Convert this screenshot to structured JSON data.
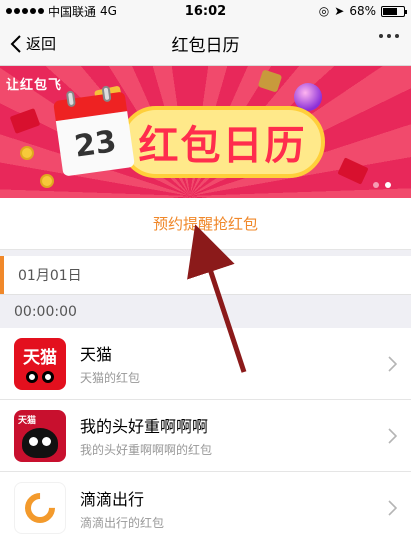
{
  "statusbar": {
    "carrier": "中国联通",
    "network": "4G",
    "time": "16:02",
    "battery": "68%",
    "battery_level": 0.68
  },
  "navbar": {
    "back_label": "返回",
    "title": "红包日历"
  },
  "banner": {
    "logo_text": "让红包飞",
    "calendar_day": "23",
    "headline": "红包日历",
    "page_count": 2,
    "active_page": 1
  },
  "reminder": {
    "label": "预约提醒抢红包",
    "color": "#f0882a"
  },
  "schedule": {
    "date": "01月01日",
    "time": "00:00:00",
    "items": [
      {
        "name": "天猫",
        "desc": "天猫的红包",
        "icon": "tmall-icon"
      },
      {
        "name": "我的头好重啊啊啊",
        "desc": "我的头好重啊啊啊的红包",
        "icon": "tmall-cat-icon"
      },
      {
        "name": "滴滴出行",
        "desc": "滴滴出行的红包",
        "icon": "didi-icon"
      }
    ]
  }
}
